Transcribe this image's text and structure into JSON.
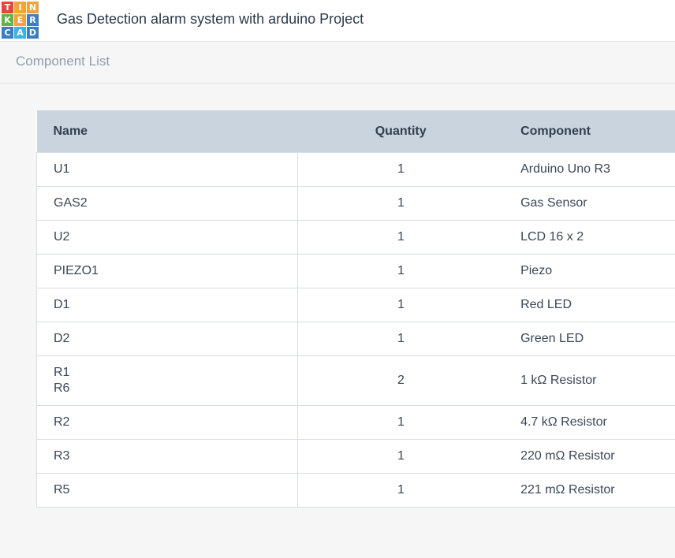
{
  "header": {
    "logo_letters": [
      "T",
      "I",
      "N",
      "K",
      "E",
      "R",
      "C",
      "A",
      "D"
    ],
    "logo_colors": [
      "#e6463d",
      "#f2a33a",
      "#f2a33a",
      "#62b24a",
      "#f2a33a",
      "#3a7fc4",
      "#3a7fc4",
      "#3fb1e3",
      "#3a7fc4"
    ],
    "title": "Gas Detection alarm system with arduino Project"
  },
  "subheader": {
    "label": "Component List"
  },
  "table": {
    "columns": [
      "Name",
      "Quantity",
      "Component"
    ],
    "rows": [
      {
        "names": [
          "U1"
        ],
        "quantity": "1",
        "component": "Arduino Uno R3"
      },
      {
        "names": [
          "GAS2"
        ],
        "quantity": "1",
        "component": "Gas Sensor"
      },
      {
        "names": [
          "U2"
        ],
        "quantity": "1",
        "component": "LCD 16 x 2"
      },
      {
        "names": [
          "PIEZO1"
        ],
        "quantity": "1",
        "component": "Piezo"
      },
      {
        "names": [
          "D1"
        ],
        "quantity": "1",
        "component": "Red LED"
      },
      {
        "names": [
          "D2"
        ],
        "quantity": "1",
        "component": "Green LED"
      },
      {
        "names": [
          "R1",
          "R6"
        ],
        "quantity": "2",
        "component": "1 kΩ Resistor"
      },
      {
        "names": [
          "R2"
        ],
        "quantity": "1",
        "component": "4.7 kΩ Resistor"
      },
      {
        "names": [
          "R3"
        ],
        "quantity": "1",
        "component": "220 mΩ Resistor"
      },
      {
        "names": [
          "R5"
        ],
        "quantity": "1",
        "component": "221 mΩ Resistor"
      }
    ]
  }
}
